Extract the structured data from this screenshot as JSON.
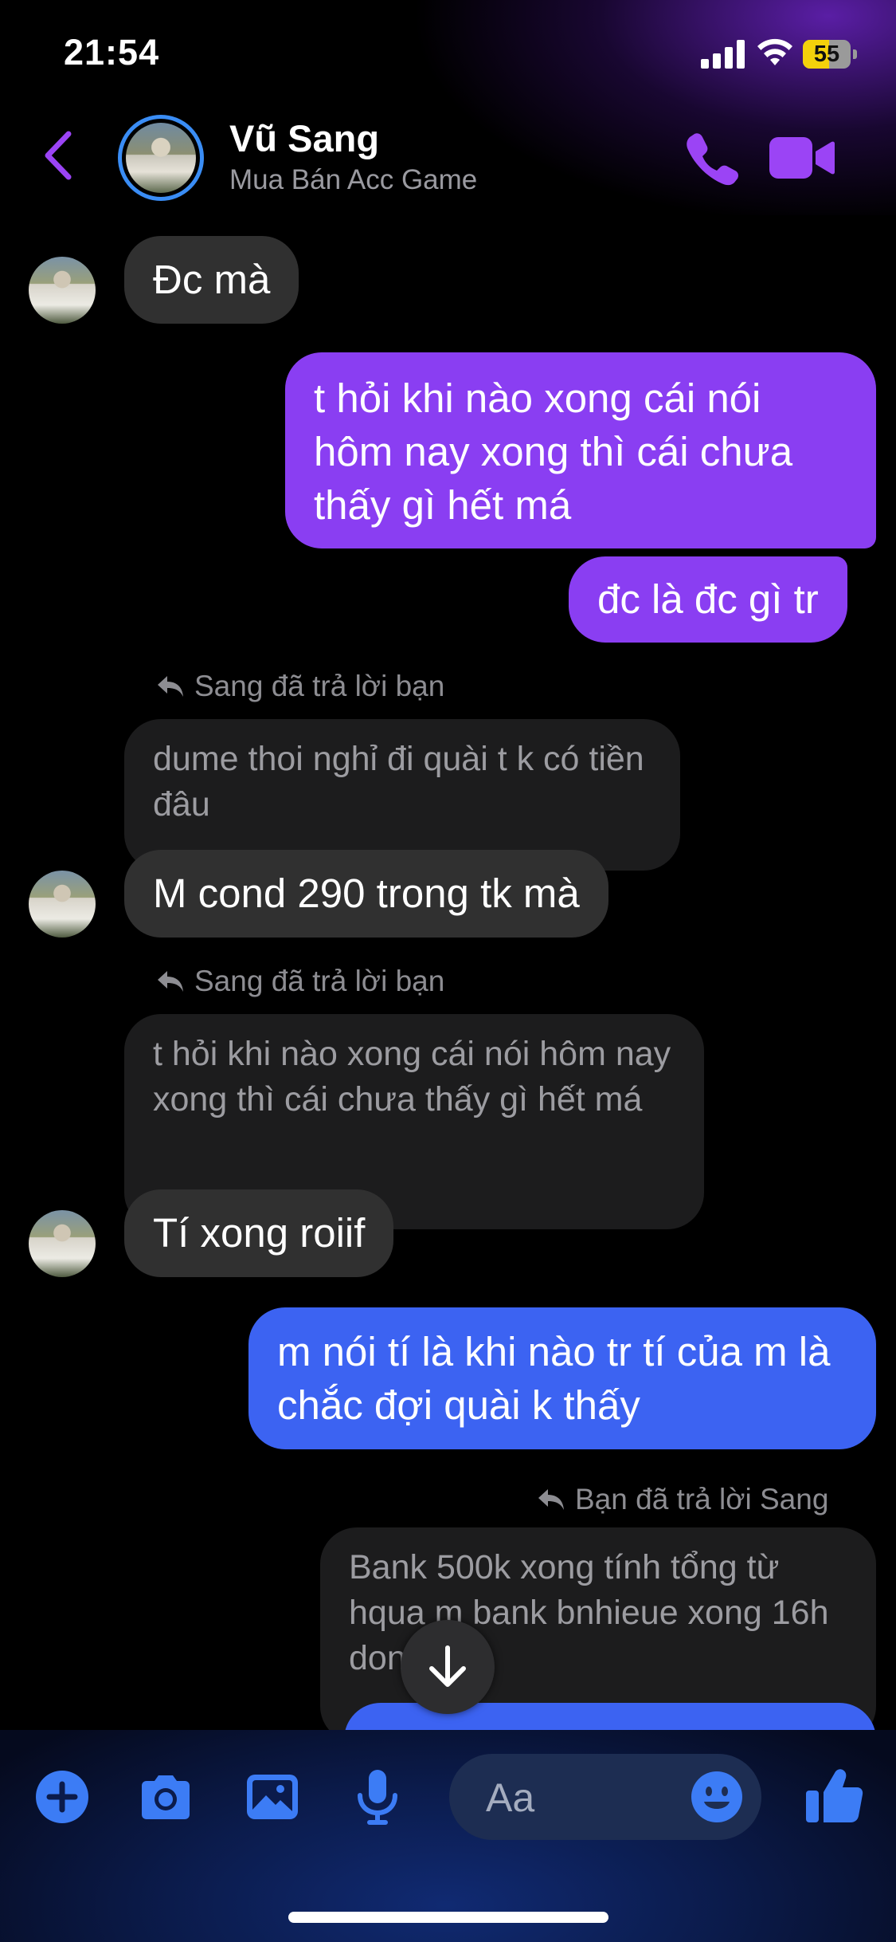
{
  "status_bar": {
    "time": "21:54",
    "battery_percent": "55",
    "battery_level": 0.55,
    "icons": [
      "signal-icon",
      "wifi-icon",
      "battery-icon"
    ]
  },
  "header": {
    "back_icon": "chevron-left-icon",
    "contact_name": "Vũ Sang",
    "subtitle": "Mua Bán Acc Game",
    "call_icon": "phone-icon",
    "video_icon": "video-camera-icon",
    "accent_color": "#9b44f5"
  },
  "messages": [
    {
      "side": "in",
      "text": "Đc mà"
    },
    {
      "side": "out",
      "text": "t hỏi khi nào xong cái nói hôm nay xong thì cái chưa thấy gì hết má",
      "color": "#8a3ef2"
    },
    {
      "side": "out",
      "text": "đc là đc gì tr",
      "color": "#8a3ef2"
    },
    {
      "side": "in",
      "reply_label": "Sang đã trả lời bạn",
      "quoted": "dume thoi nghỉ đi quài t k có tiền đâu",
      "text": "M cond 290 trong tk mà"
    },
    {
      "side": "in",
      "reply_label": "Sang đã trả lời bạn",
      "quoted": "t hỏi khi nào xong cái nói hôm nay xong thì cái chưa thấy gì hết má",
      "text": "Tí xong roiif"
    },
    {
      "side": "out",
      "text": "m nói tí là khi nào tr tí của m là chắc đợi quài k thấy",
      "color": "#3c63f2"
    },
    {
      "side": "out",
      "reply_label": "Bạn đã trả lời Sang",
      "quoted": "Bank 500k xong tính tổng từ hqua m bank bnhieue xong 16h done m",
      "text": "",
      "color": "#3c63f2"
    }
  ],
  "scroll_button": {
    "icon": "arrow-down-icon"
  },
  "composer": {
    "placeholder": "Aa",
    "tools": [
      "plus-icon",
      "camera-icon",
      "image-icon",
      "microphone-icon"
    ],
    "emoji_icon": "smiley-icon",
    "like_icon": "thumbs-up-icon",
    "accent_color": "#3c7cf5"
  }
}
